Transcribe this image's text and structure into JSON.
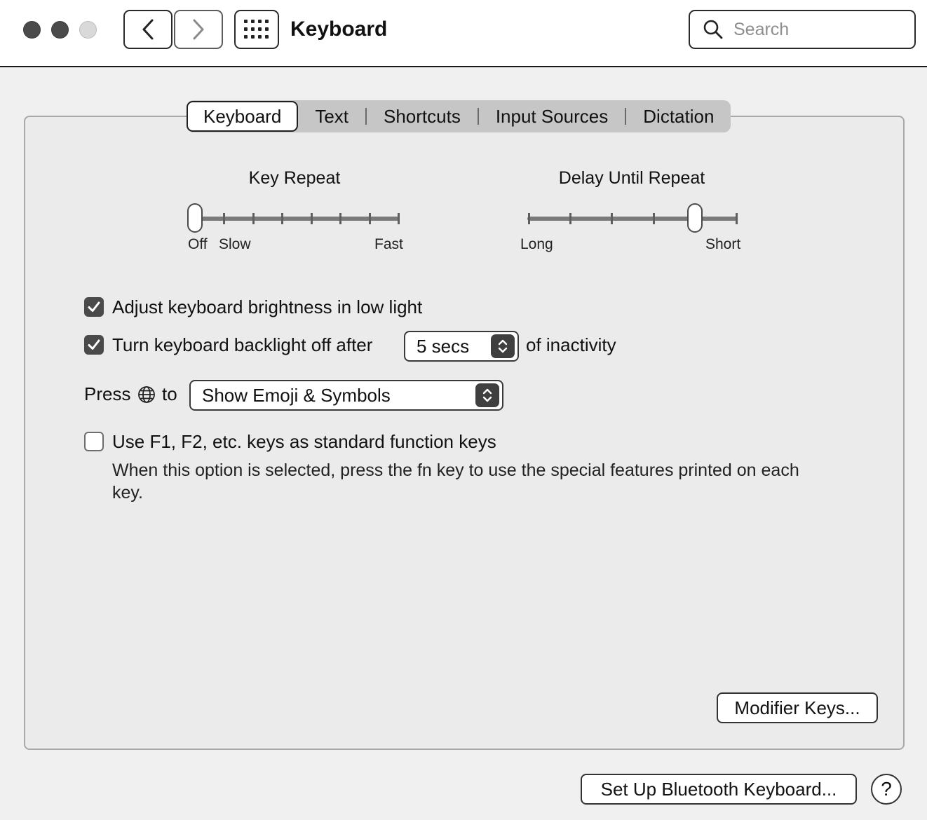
{
  "window": {
    "title": "Keyboard",
    "search_placeholder": "Search"
  },
  "tabs": [
    {
      "label": "Keyboard",
      "active": true
    },
    {
      "label": "Text",
      "active": false
    },
    {
      "label": "Shortcuts",
      "active": false
    },
    {
      "label": "Input Sources",
      "active": false
    },
    {
      "label": "Dictation",
      "active": false
    }
  ],
  "key_repeat": {
    "title": "Key Repeat",
    "labels": {
      "off": "Off",
      "slow": "Slow",
      "fast": "Fast"
    },
    "position_index": 0,
    "stops": 8
  },
  "delay_until_repeat": {
    "title": "Delay Until Repeat",
    "labels": {
      "long": "Long",
      "short": "Short"
    },
    "position_index": 4,
    "stops": 6
  },
  "options": {
    "brightness": {
      "label": "Adjust keyboard brightness in low light",
      "checked": true
    },
    "backlight": {
      "label": "Turn keyboard backlight off after",
      "checked": true,
      "value": "5 secs",
      "suffix": "of inactivity"
    },
    "press_globe": {
      "prefix": "Press",
      "suffix": "to",
      "value": "Show Emoji & Symbols"
    },
    "function_keys": {
      "label": "Use F1, F2, etc. keys as standard function keys",
      "checked": false,
      "note": "When this option is selected, press the fn key to use the special features printed on each key."
    }
  },
  "buttons": {
    "modifier_keys": "Modifier Keys...",
    "bluetooth": "Set Up Bluetooth Keyboard...",
    "help": "?"
  },
  "colors": {
    "checkbox_on": "#4a4a4a",
    "tab_bar": "#c6c6c6",
    "panel": "#ebebeb"
  }
}
